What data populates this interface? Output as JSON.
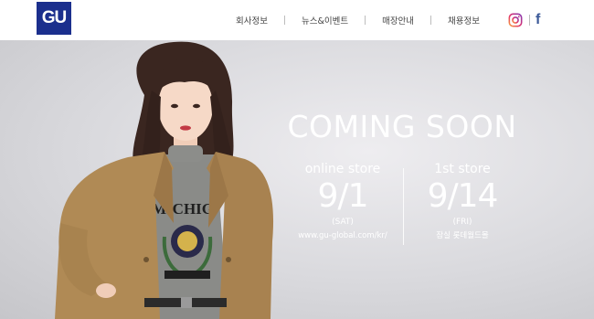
{
  "brand": {
    "logo_text": "GU",
    "color": "#1b2f8d"
  },
  "nav": {
    "items": [
      {
        "label": "회사정보"
      },
      {
        "label": "뉴스&이벤트"
      },
      {
        "label": "매장안내"
      },
      {
        "label": "채용정보"
      }
    ]
  },
  "social": {
    "instagram_icon": "instagram-icon",
    "facebook_icon": "facebook-icon",
    "facebook_glyph": "f"
  },
  "hero": {
    "headline": "COMING SOON",
    "online": {
      "label": "online store",
      "date": "9/1",
      "day": "(SAT)",
      "url": "www.gu-global.com/kr/"
    },
    "store": {
      "label": "1st store",
      "date": "9/14",
      "day": "(FRI)",
      "location": "잠실 롯데월드몰"
    },
    "colors": {
      "text": "#ffffff",
      "coat": "#b08a55",
      "sweater": "#8a8b88"
    }
  }
}
